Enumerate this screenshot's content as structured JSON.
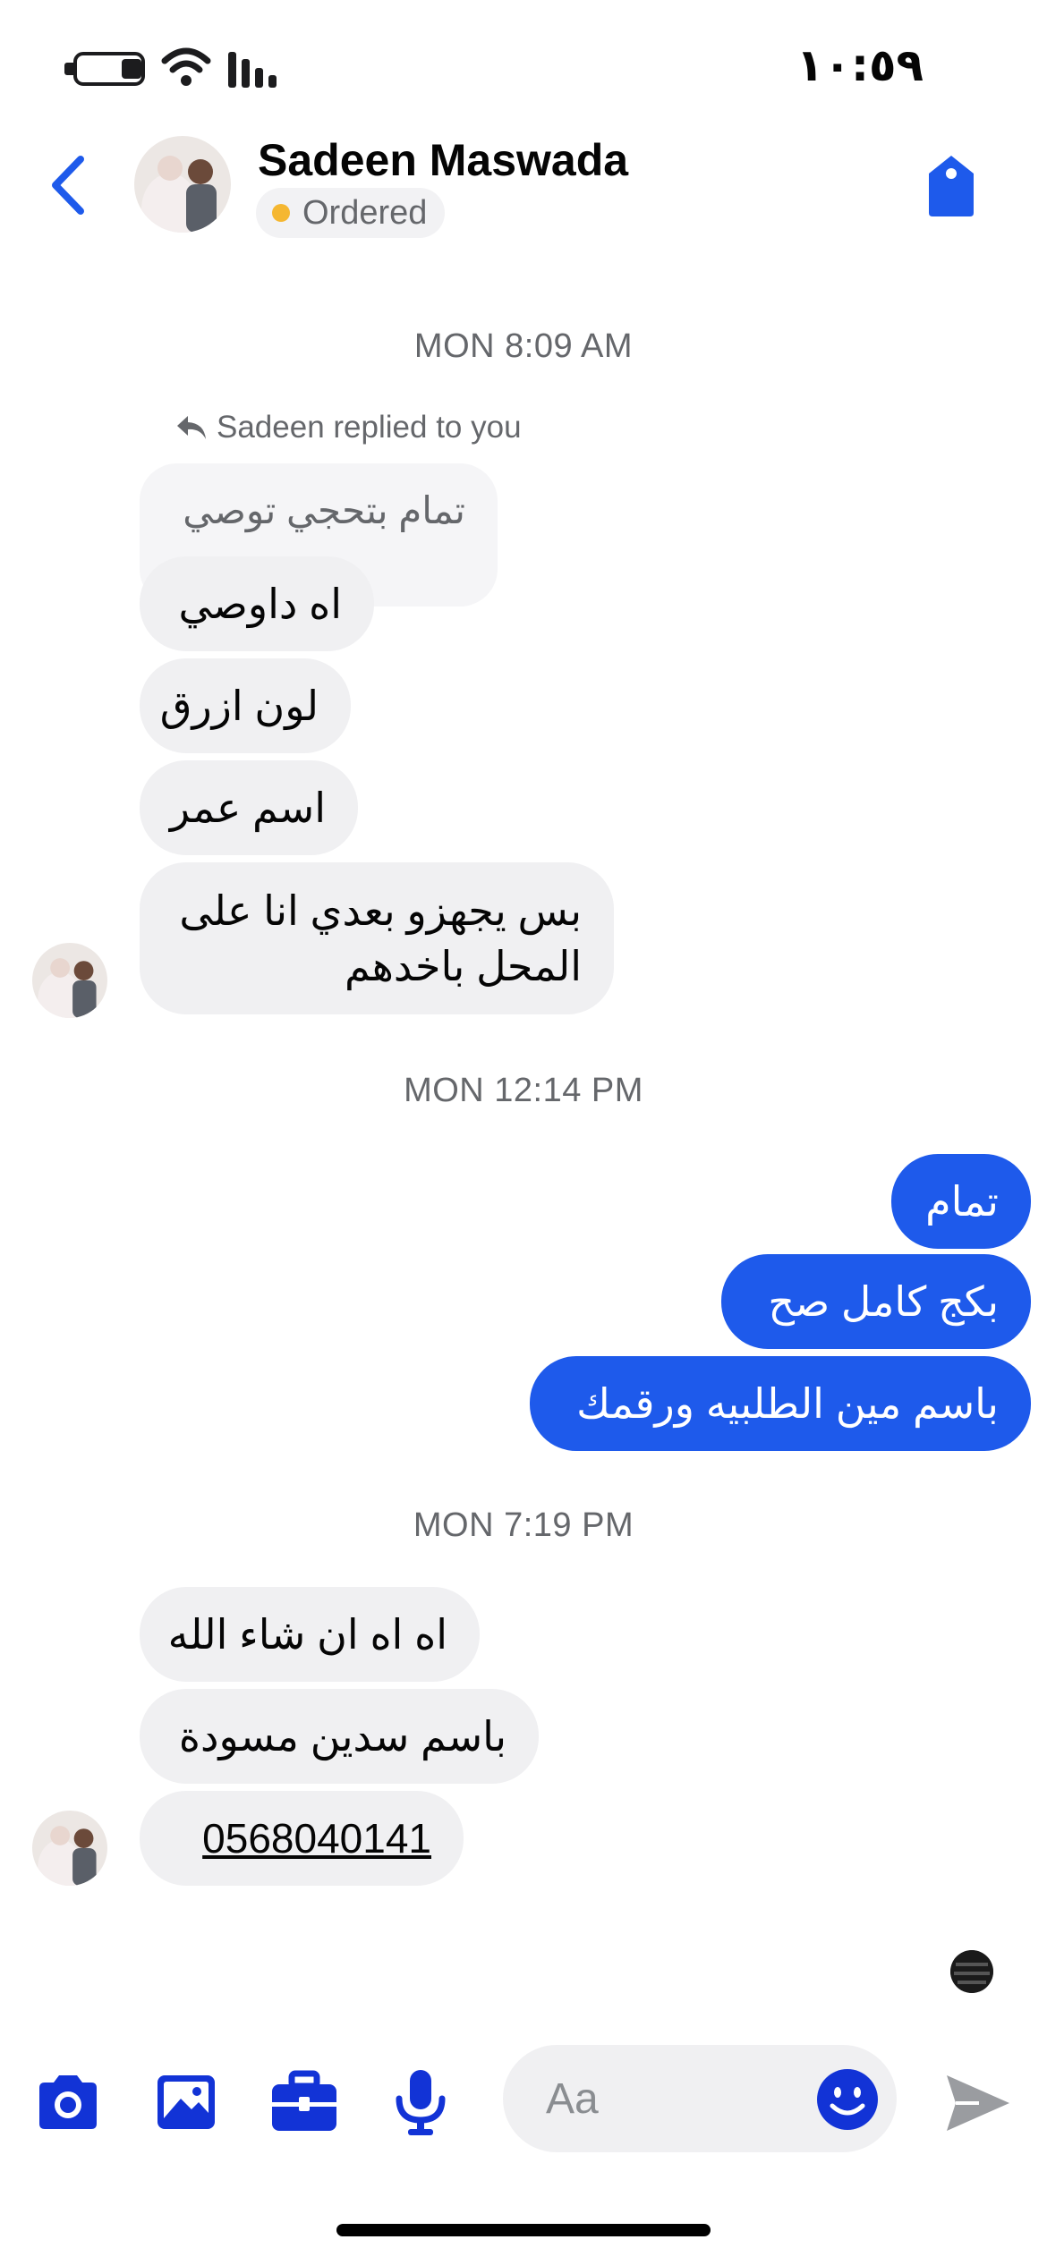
{
  "status_bar": {
    "time": "١٠:٥٩",
    "icons": [
      "battery-icon",
      "wifi-icon",
      "signal-icon"
    ]
  },
  "header": {
    "contact_name": "Sadeen Maswada",
    "status": "Ordered",
    "status_color": "#f5b731",
    "icons": [
      "back-chevron-icon",
      "tag-icon"
    ]
  },
  "chat": {
    "groups": [
      {
        "timestamp": "MON 8:09 AM",
        "reply_note": "Sadeen replied to you",
        "quoted_message": "تمام بتحجي توصي",
        "messages": [
          {
            "direction": "in",
            "text": "اه داوصي"
          },
          {
            "direction": "in",
            "text": "لون ازرق"
          },
          {
            "direction": "in",
            "text": "اسم عمر"
          },
          {
            "direction": "in",
            "text": "بس يجهزو بعدي انا على المحل باخدهم"
          }
        ]
      },
      {
        "timestamp": "MON 12:14 PM",
        "messages": [
          {
            "direction": "out",
            "text": "تمام"
          },
          {
            "direction": "out",
            "text": "بكج كامل صح"
          },
          {
            "direction": "out",
            "text": "باسم مين الطلبيه ورقمك"
          }
        ]
      },
      {
        "timestamp": "MON 7:19 PM",
        "messages": [
          {
            "direction": "in",
            "text": "اه اه ان شاء الله"
          },
          {
            "direction": "in",
            "text": "باسم سدين مسودة"
          },
          {
            "direction": "in",
            "text": "0568040141"
          }
        ]
      }
    ]
  },
  "composer": {
    "placeholder": "Aa",
    "tools": [
      "camera-icon",
      "gallery-icon",
      "briefcase-icon",
      "microphone-icon"
    ],
    "emoji_icon": "smiley-icon",
    "send_icon": "send-icon"
  },
  "colors": {
    "accent": "#1e5aeb",
    "incoming_bubble": "#f0f0f2",
    "icon_blue": "#1233d6"
  }
}
